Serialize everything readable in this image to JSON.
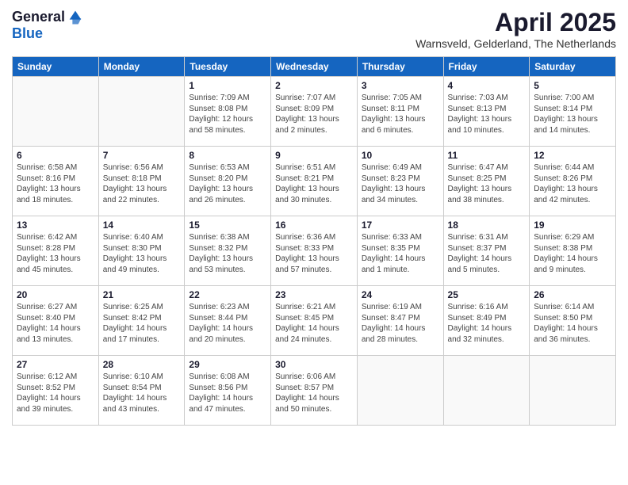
{
  "header": {
    "logo_line1": "General",
    "logo_line2": "Blue",
    "title": "April 2025",
    "location": "Warnsveld, Gelderland, The Netherlands"
  },
  "days_of_week": [
    "Sunday",
    "Monday",
    "Tuesday",
    "Wednesday",
    "Thursday",
    "Friday",
    "Saturday"
  ],
  "weeks": [
    [
      {
        "day": "",
        "info": ""
      },
      {
        "day": "",
        "info": ""
      },
      {
        "day": "1",
        "info": "Sunrise: 7:09 AM\nSunset: 8:08 PM\nDaylight: 12 hours\nand 58 minutes."
      },
      {
        "day": "2",
        "info": "Sunrise: 7:07 AM\nSunset: 8:09 PM\nDaylight: 13 hours\nand 2 minutes."
      },
      {
        "day": "3",
        "info": "Sunrise: 7:05 AM\nSunset: 8:11 PM\nDaylight: 13 hours\nand 6 minutes."
      },
      {
        "day": "4",
        "info": "Sunrise: 7:03 AM\nSunset: 8:13 PM\nDaylight: 13 hours\nand 10 minutes."
      },
      {
        "day": "5",
        "info": "Sunrise: 7:00 AM\nSunset: 8:14 PM\nDaylight: 13 hours\nand 14 minutes."
      }
    ],
    [
      {
        "day": "6",
        "info": "Sunrise: 6:58 AM\nSunset: 8:16 PM\nDaylight: 13 hours\nand 18 minutes."
      },
      {
        "day": "7",
        "info": "Sunrise: 6:56 AM\nSunset: 8:18 PM\nDaylight: 13 hours\nand 22 minutes."
      },
      {
        "day": "8",
        "info": "Sunrise: 6:53 AM\nSunset: 8:20 PM\nDaylight: 13 hours\nand 26 minutes."
      },
      {
        "day": "9",
        "info": "Sunrise: 6:51 AM\nSunset: 8:21 PM\nDaylight: 13 hours\nand 30 minutes."
      },
      {
        "day": "10",
        "info": "Sunrise: 6:49 AM\nSunset: 8:23 PM\nDaylight: 13 hours\nand 34 minutes."
      },
      {
        "day": "11",
        "info": "Sunrise: 6:47 AM\nSunset: 8:25 PM\nDaylight: 13 hours\nand 38 minutes."
      },
      {
        "day": "12",
        "info": "Sunrise: 6:44 AM\nSunset: 8:26 PM\nDaylight: 13 hours\nand 42 minutes."
      }
    ],
    [
      {
        "day": "13",
        "info": "Sunrise: 6:42 AM\nSunset: 8:28 PM\nDaylight: 13 hours\nand 45 minutes."
      },
      {
        "day": "14",
        "info": "Sunrise: 6:40 AM\nSunset: 8:30 PM\nDaylight: 13 hours\nand 49 minutes."
      },
      {
        "day": "15",
        "info": "Sunrise: 6:38 AM\nSunset: 8:32 PM\nDaylight: 13 hours\nand 53 minutes."
      },
      {
        "day": "16",
        "info": "Sunrise: 6:36 AM\nSunset: 8:33 PM\nDaylight: 13 hours\nand 57 minutes."
      },
      {
        "day": "17",
        "info": "Sunrise: 6:33 AM\nSunset: 8:35 PM\nDaylight: 14 hours\nand 1 minute."
      },
      {
        "day": "18",
        "info": "Sunrise: 6:31 AM\nSunset: 8:37 PM\nDaylight: 14 hours\nand 5 minutes."
      },
      {
        "day": "19",
        "info": "Sunrise: 6:29 AM\nSunset: 8:38 PM\nDaylight: 14 hours\nand 9 minutes."
      }
    ],
    [
      {
        "day": "20",
        "info": "Sunrise: 6:27 AM\nSunset: 8:40 PM\nDaylight: 14 hours\nand 13 minutes."
      },
      {
        "day": "21",
        "info": "Sunrise: 6:25 AM\nSunset: 8:42 PM\nDaylight: 14 hours\nand 17 minutes."
      },
      {
        "day": "22",
        "info": "Sunrise: 6:23 AM\nSunset: 8:44 PM\nDaylight: 14 hours\nand 20 minutes."
      },
      {
        "day": "23",
        "info": "Sunrise: 6:21 AM\nSunset: 8:45 PM\nDaylight: 14 hours\nand 24 minutes."
      },
      {
        "day": "24",
        "info": "Sunrise: 6:19 AM\nSunset: 8:47 PM\nDaylight: 14 hours\nand 28 minutes."
      },
      {
        "day": "25",
        "info": "Sunrise: 6:16 AM\nSunset: 8:49 PM\nDaylight: 14 hours\nand 32 minutes."
      },
      {
        "day": "26",
        "info": "Sunrise: 6:14 AM\nSunset: 8:50 PM\nDaylight: 14 hours\nand 36 minutes."
      }
    ],
    [
      {
        "day": "27",
        "info": "Sunrise: 6:12 AM\nSunset: 8:52 PM\nDaylight: 14 hours\nand 39 minutes."
      },
      {
        "day": "28",
        "info": "Sunrise: 6:10 AM\nSunset: 8:54 PM\nDaylight: 14 hours\nand 43 minutes."
      },
      {
        "day": "29",
        "info": "Sunrise: 6:08 AM\nSunset: 8:56 PM\nDaylight: 14 hours\nand 47 minutes."
      },
      {
        "day": "30",
        "info": "Sunrise: 6:06 AM\nSunset: 8:57 PM\nDaylight: 14 hours\nand 50 minutes."
      },
      {
        "day": "",
        "info": ""
      },
      {
        "day": "",
        "info": ""
      },
      {
        "day": "",
        "info": ""
      }
    ]
  ]
}
